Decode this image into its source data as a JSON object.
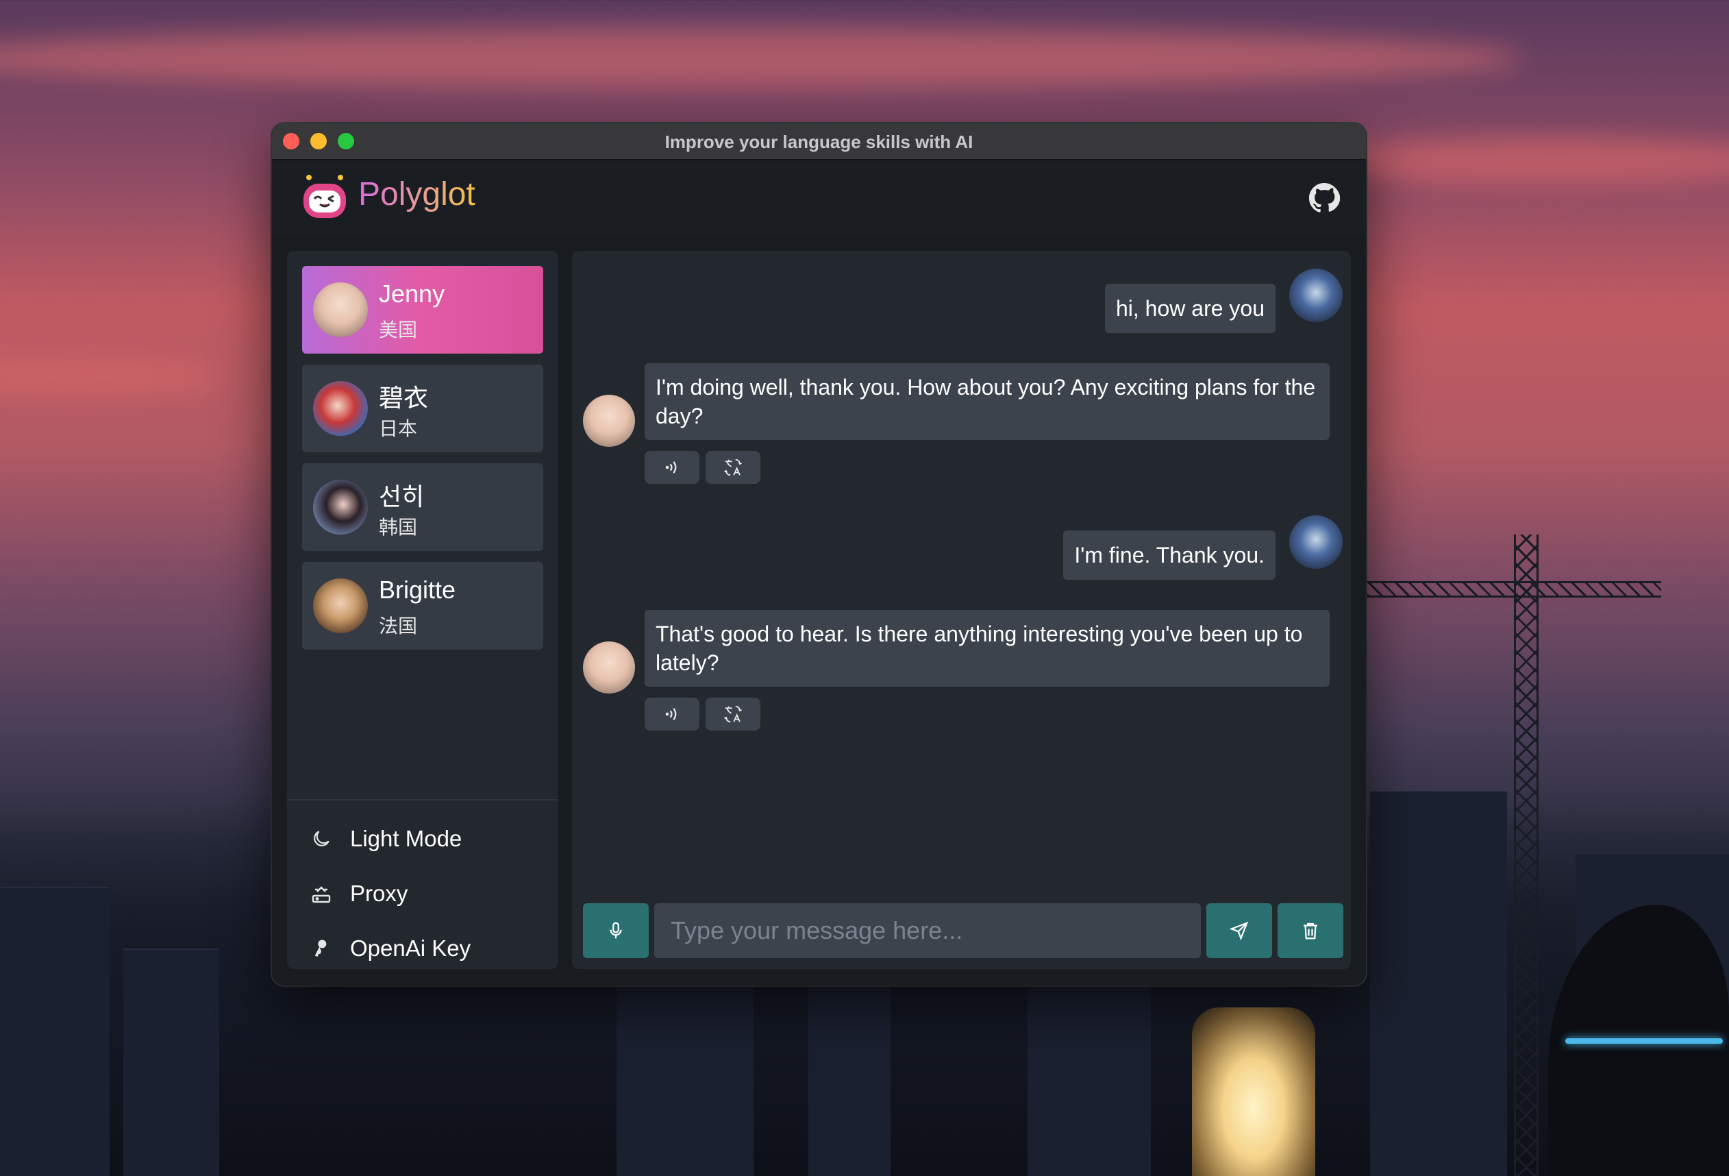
{
  "window": {
    "title": "Improve your language skills with AI"
  },
  "header": {
    "brand": "Polyglot",
    "logo_icon": "robot-logo-icon",
    "github_icon": "github-icon"
  },
  "contacts": [
    {
      "name": "Jenny",
      "country": "美国",
      "active": true
    },
    {
      "name": "碧衣",
      "country": "日本",
      "active": false
    },
    {
      "name": "선히",
      "country": "韩国",
      "active": false
    },
    {
      "name": "Brigitte",
      "country": "法国",
      "active": false
    }
  ],
  "sidebar_options": [
    {
      "label": "Light Mode",
      "icon": "moon-icon"
    },
    {
      "label": "Proxy",
      "icon": "proxy-icon"
    },
    {
      "label": "OpenAi Key",
      "icon": "key-icon"
    }
  ],
  "messages": [
    {
      "role": "user",
      "text": "hi, how are you"
    },
    {
      "role": "assistant",
      "text": "I'm doing well, thank you. How about you? Any exciting plans for the day?"
    },
    {
      "role": "user",
      "text": "I'm fine. Thank you."
    },
    {
      "role": "assistant",
      "text": "That's good to hear. Is there anything interesting you've been up to lately?"
    }
  ],
  "input": {
    "placeholder": "Type your message here..."
  },
  "colors": {
    "accent": "#2a7070",
    "active_contact": "#e35aa6",
    "bubble": "#3c434d"
  }
}
